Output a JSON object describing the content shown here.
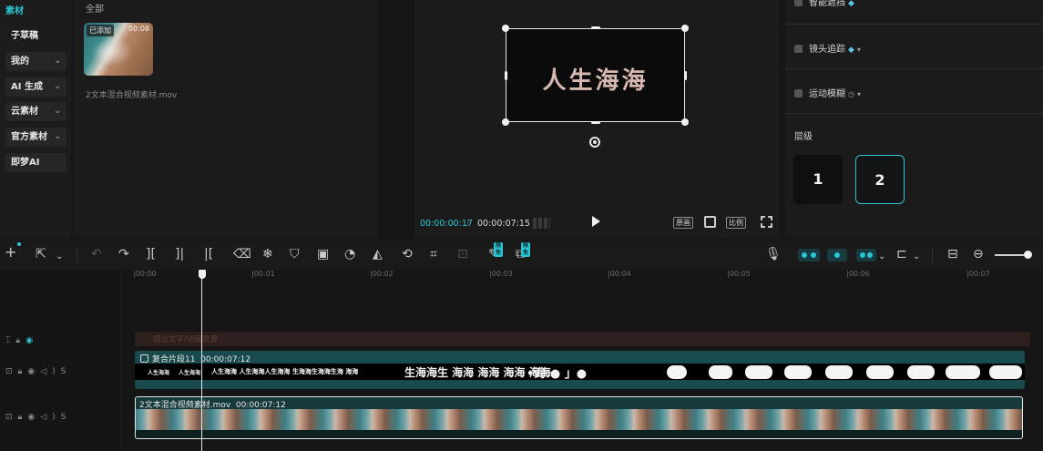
{
  "left_nav": {
    "active_label": "素材",
    "items": [
      {
        "label": "子草稿",
        "has_chevron": false
      },
      {
        "label": "我的",
        "has_chevron": true
      },
      {
        "label": "AI 生成",
        "has_chevron": true
      },
      {
        "label": "云素材",
        "has_chevron": true
      },
      {
        "label": "官方素材",
        "has_chevron": true
      },
      {
        "label": "即梦AI",
        "has_chevron": false
      }
    ],
    "chevron": "⌄"
  },
  "media": {
    "section_title": "全部",
    "thumb_badge": "已添加",
    "thumb_duration": "00:08",
    "filename": "2文本混合视频素材.mov"
  },
  "player": {
    "preview_text": "人生海海",
    "time_current": "00:00:00:17",
    "time_separator": "/",
    "time_total": "00:00:07:15",
    "btn_original": "原画",
    "btn_ratio": "比例"
  },
  "properties": {
    "smart_fill_label": "智能遮挡",
    "tracking_label": "镜头追踪",
    "motion_blur_label": "运动模糊",
    "layer_label": "层级",
    "layers": [
      "1",
      "2"
    ],
    "selected_layer": "2"
  },
  "toolbar": {
    "free_badge_1": "限免",
    "free_badge_2": "限免"
  },
  "timeline": {
    "ruler_ticks": [
      "|00:00",
      "|00:01",
      "|00:02",
      "|00:03",
      "|00:04",
      "|00:05",
      "|00:06",
      "|00:07"
    ],
    "text_track_label": "组合文字/动画资源",
    "compound_clip_label": "复合片段11",
    "compound_clip_duration": "00:00:07:12",
    "video_clip_label": "2文本混合视频素材.mov",
    "video_clip_duration": "00:00:07:12",
    "track_controls": "S"
  },
  "colors": {
    "accent": "#2bc5d5",
    "panel": "#1b1b1b",
    "clip_teal": "#194a4d"
  }
}
